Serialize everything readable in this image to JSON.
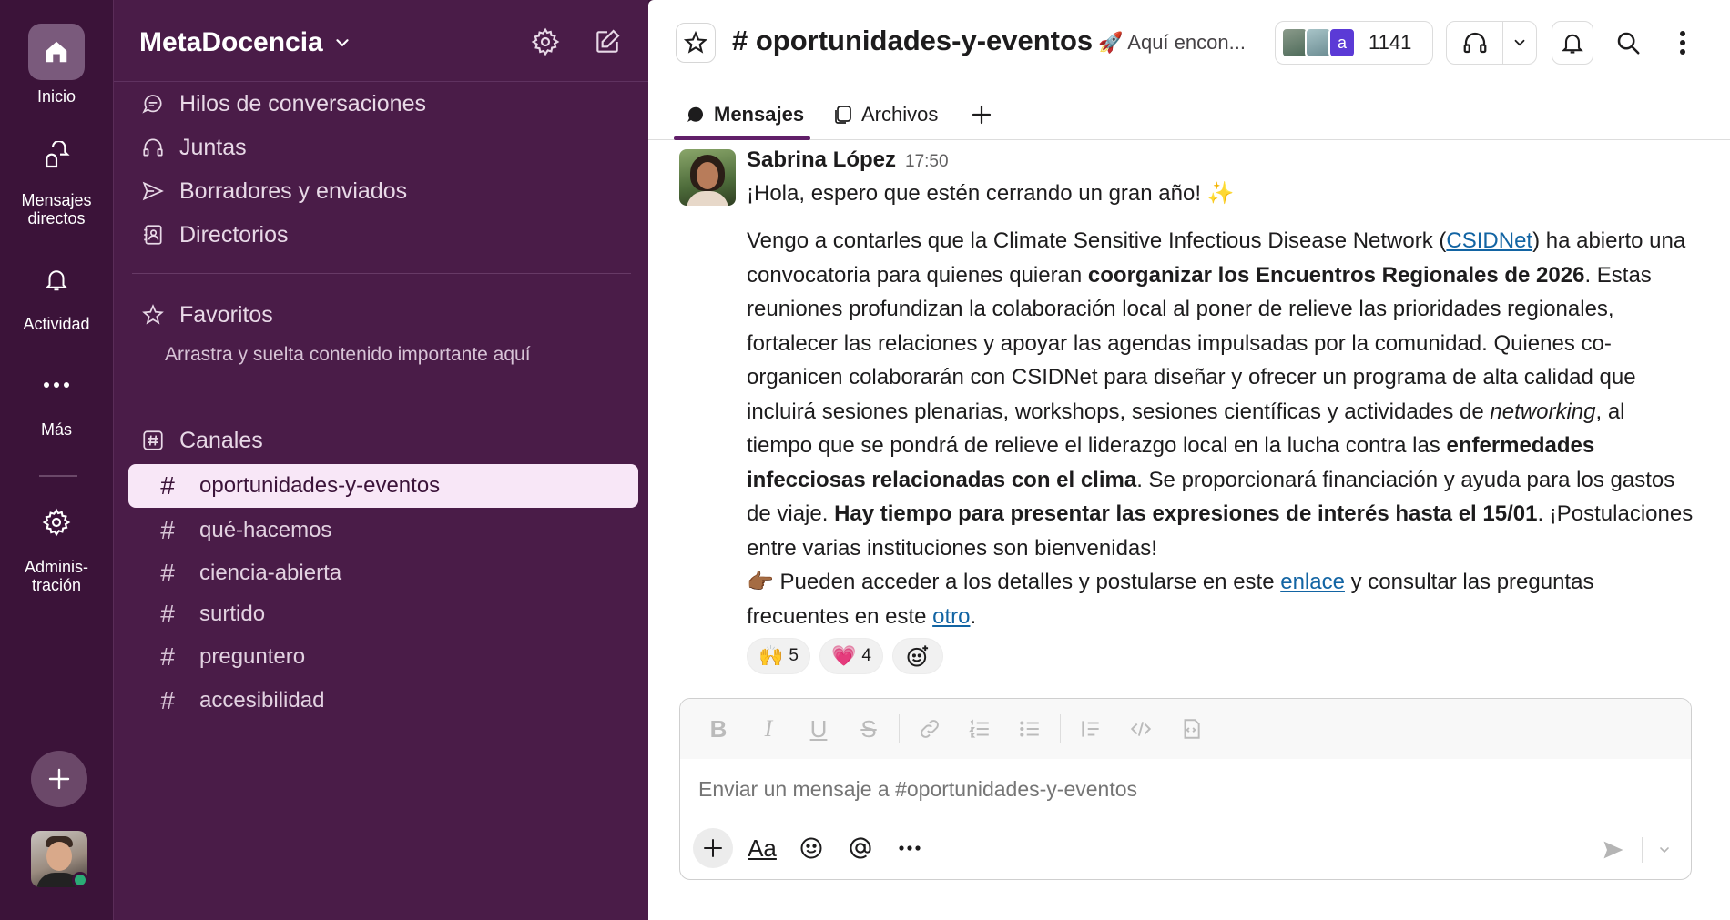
{
  "rail": {
    "home": "Inicio",
    "dms_line1": "Mensajes",
    "dms_line2": "directos",
    "activity": "Actividad",
    "more": "Más",
    "admin_line1": "Adminis-",
    "admin_line2": "tración"
  },
  "workspace": {
    "name": "MetaDocencia"
  },
  "sidebar": {
    "nav": [
      "Hilos de conversaciones",
      "Juntas",
      "Borradores y enviados",
      "Directorios"
    ],
    "favorites_label": "Favoritos",
    "favorites_hint": "Arrastra y suelta contenido importante aquí",
    "channels_label": "Canales",
    "channels": [
      "oportunidades-y-eventos",
      "qué-hacemos",
      "ciencia-abierta",
      "surtido",
      "preguntero",
      "accesibilidad"
    ],
    "active_channel": "oportunidades-y-eventos"
  },
  "header": {
    "channel_title": "# oportunidades-y-eventos",
    "topic": "🚀 Aquí encon...",
    "member_badge_letter": "a",
    "member_count": "1141"
  },
  "tabs": {
    "messages": "Mensajes",
    "files": "Archivos"
  },
  "message": {
    "author": "Sabrina López",
    "time": "17:50",
    "greeting": "¡Hola, espero que estén cerrando un gran año! ✨",
    "p1_a": "Vengo a contarles que la Climate Sensitive Infectious Disease Network (",
    "p1_link": "CSIDNet",
    "p1_b": ") ha abierto una convocatoria para quienes quieran ",
    "p1_bold": "coorganizar los Encuentros Regionales de 2026",
    "p1_c": ". Estas reuniones profundizan la colaboración local al poner de relieve las prioridades regionales, fortalecer las relaciones y apoyar las agendas impulsadas por la comunidad. Quienes co-organicen colaborarán con CSIDNet para diseñar y ofrecer un programa de alta calidad que incluirá sesiones plenarias, workshops, sesiones científicas y actividades de ",
    "p1_italic": "networking",
    "p1_d": ", al tiempo que se pondrá de relieve el liderazgo local en la lucha contra las ",
    "p1_bold2": "enfermedades infecciosas relacionadas con el clima",
    "p1_e": ". Se proporcionará financiación y ayuda para los gastos de viaje. ",
    "p1_bold3": "Hay tiempo para presentar las expresiones de interés hasta el 15/01",
    "p1_f": ". ¡Postulaciones entre varias instituciones son bienvenidas!",
    "p2_a": "👉🏾 Pueden acceder a los detalles y postularse en este ",
    "p2_link1": "enlace",
    "p2_b": " y consultar las preguntas frecuentes en este ",
    "p2_link2": "otro",
    "p2_c": "."
  },
  "reactions": [
    {
      "emoji": "🙌",
      "count": "5"
    },
    {
      "emoji": "💗",
      "count": "4"
    }
  ],
  "composer": {
    "placeholder": "Enviar un mensaje a #oportunidades-y-eventos"
  },
  "colors": {
    "sidebar": "#4a1c48",
    "rail": "#3b1339",
    "active_channel_bg": "#f8e7f7",
    "link": "#1264a3",
    "online": "#2bac76"
  }
}
